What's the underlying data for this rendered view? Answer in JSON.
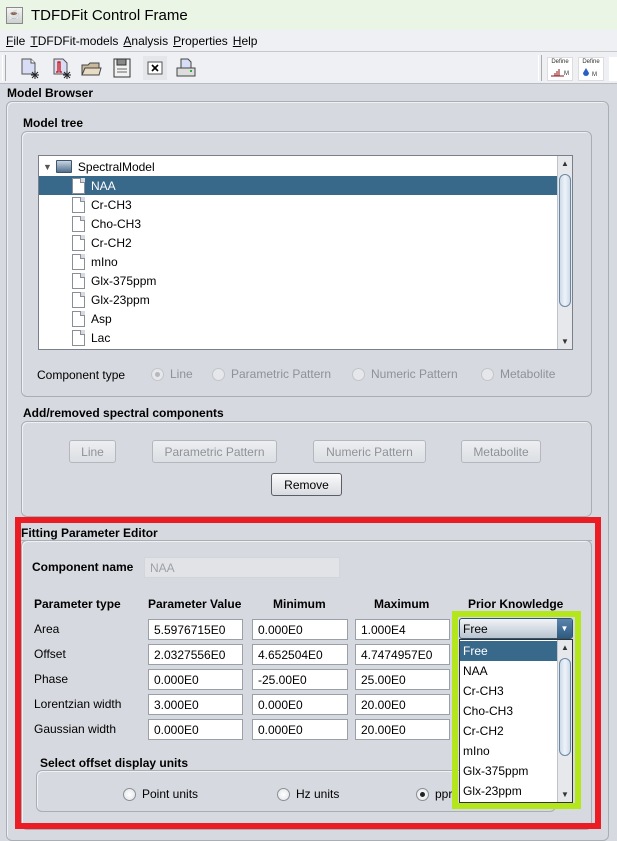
{
  "window": {
    "title": "TDFDFit Control Frame"
  },
  "menu": [
    {
      "label": "File",
      "mnemonic": "F"
    },
    {
      "label": "TDFDFit-models",
      "mnemonic": "T"
    },
    {
      "label": "Analysis",
      "mnemonic": "A"
    },
    {
      "label": "Properties",
      "mnemonic": "P"
    },
    {
      "label": "Help",
      "mnemonic": "H"
    }
  ],
  "toolbar": {
    "icons": [
      "new-document-icon",
      "new-spectrum-icon",
      "open-folder-icon",
      "save-icon",
      "close-icon",
      "print-icon"
    ],
    "define_buttons": [
      {
        "label": "Define",
        "sub": "M",
        "icon": "spectrum-lines-icon"
      },
      {
        "label": "Define",
        "sub": "M",
        "icon": "droplet-icon"
      }
    ]
  },
  "model_browser": {
    "title": "Model Browser",
    "model_tree": {
      "title": "Model tree",
      "root": "SpectralModel",
      "items": [
        "NAA",
        "Cr-CH3",
        "Cho-CH3",
        "Cr-CH2",
        "mIno",
        "Glx-375ppm",
        "Glx-23ppm",
        "Asp",
        "Lac"
      ],
      "selected": "NAA",
      "component_type_label": "Component type",
      "component_types": [
        "Line",
        "Parametric Pattern",
        "Numeric Pattern",
        "Metabolite"
      ],
      "component_type_selected": "Line"
    },
    "add_remove": {
      "title": "Add/removed spectral components",
      "buttons": [
        "Line",
        "Parametric Pattern",
        "Numeric Pattern",
        "Metabolite"
      ],
      "remove_label": "Remove"
    }
  },
  "fitting_editor": {
    "title": "Fitting Parameter Editor",
    "component_name_label": "Component name",
    "component_name_value": "NAA",
    "headers": [
      "Parameter type",
      "Parameter Value",
      "Minimum",
      "Maximum",
      "Prior Knowledge"
    ],
    "rows": [
      {
        "type": "Area",
        "value": "5.5976715E0",
        "min": "0.000E0",
        "max": "1.000E4"
      },
      {
        "type": "Offset",
        "value": "2.0327556E0",
        "min": "4.652504E0",
        "max": "4.7474957E0"
      },
      {
        "type": "Phase",
        "value": "0.000E0",
        "min": "-25.00E0",
        "max": "25.00E0"
      },
      {
        "type": "Lorentzian width",
        "value": "3.000E0",
        "min": "0.000E0",
        "max": "20.00E0"
      },
      {
        "type": "Gaussian width",
        "value": "0.000E0",
        "min": "0.000E0",
        "max": "20.00E0"
      }
    ],
    "prior_knowledge": {
      "selected": "Free",
      "options": [
        "Free",
        "NAA",
        "Cr-CH3",
        "Cho-CH3",
        "Cr-CH2",
        "mIno",
        "Glx-375ppm",
        "Glx-23ppm"
      ]
    },
    "offset_units": {
      "title": "Select offset display units",
      "options": [
        "Point units",
        "Hz units",
        "ppm"
      ],
      "visible_options": [
        "Point units",
        "Hz units",
        "ppr"
      ],
      "selected": "ppm"
    }
  },
  "annotations": {
    "red_box_color": "#ec1c24",
    "green_box_color": "#b4e61c"
  },
  "colors": {
    "selection": "#39698a",
    "background": "#d6d9df"
  }
}
